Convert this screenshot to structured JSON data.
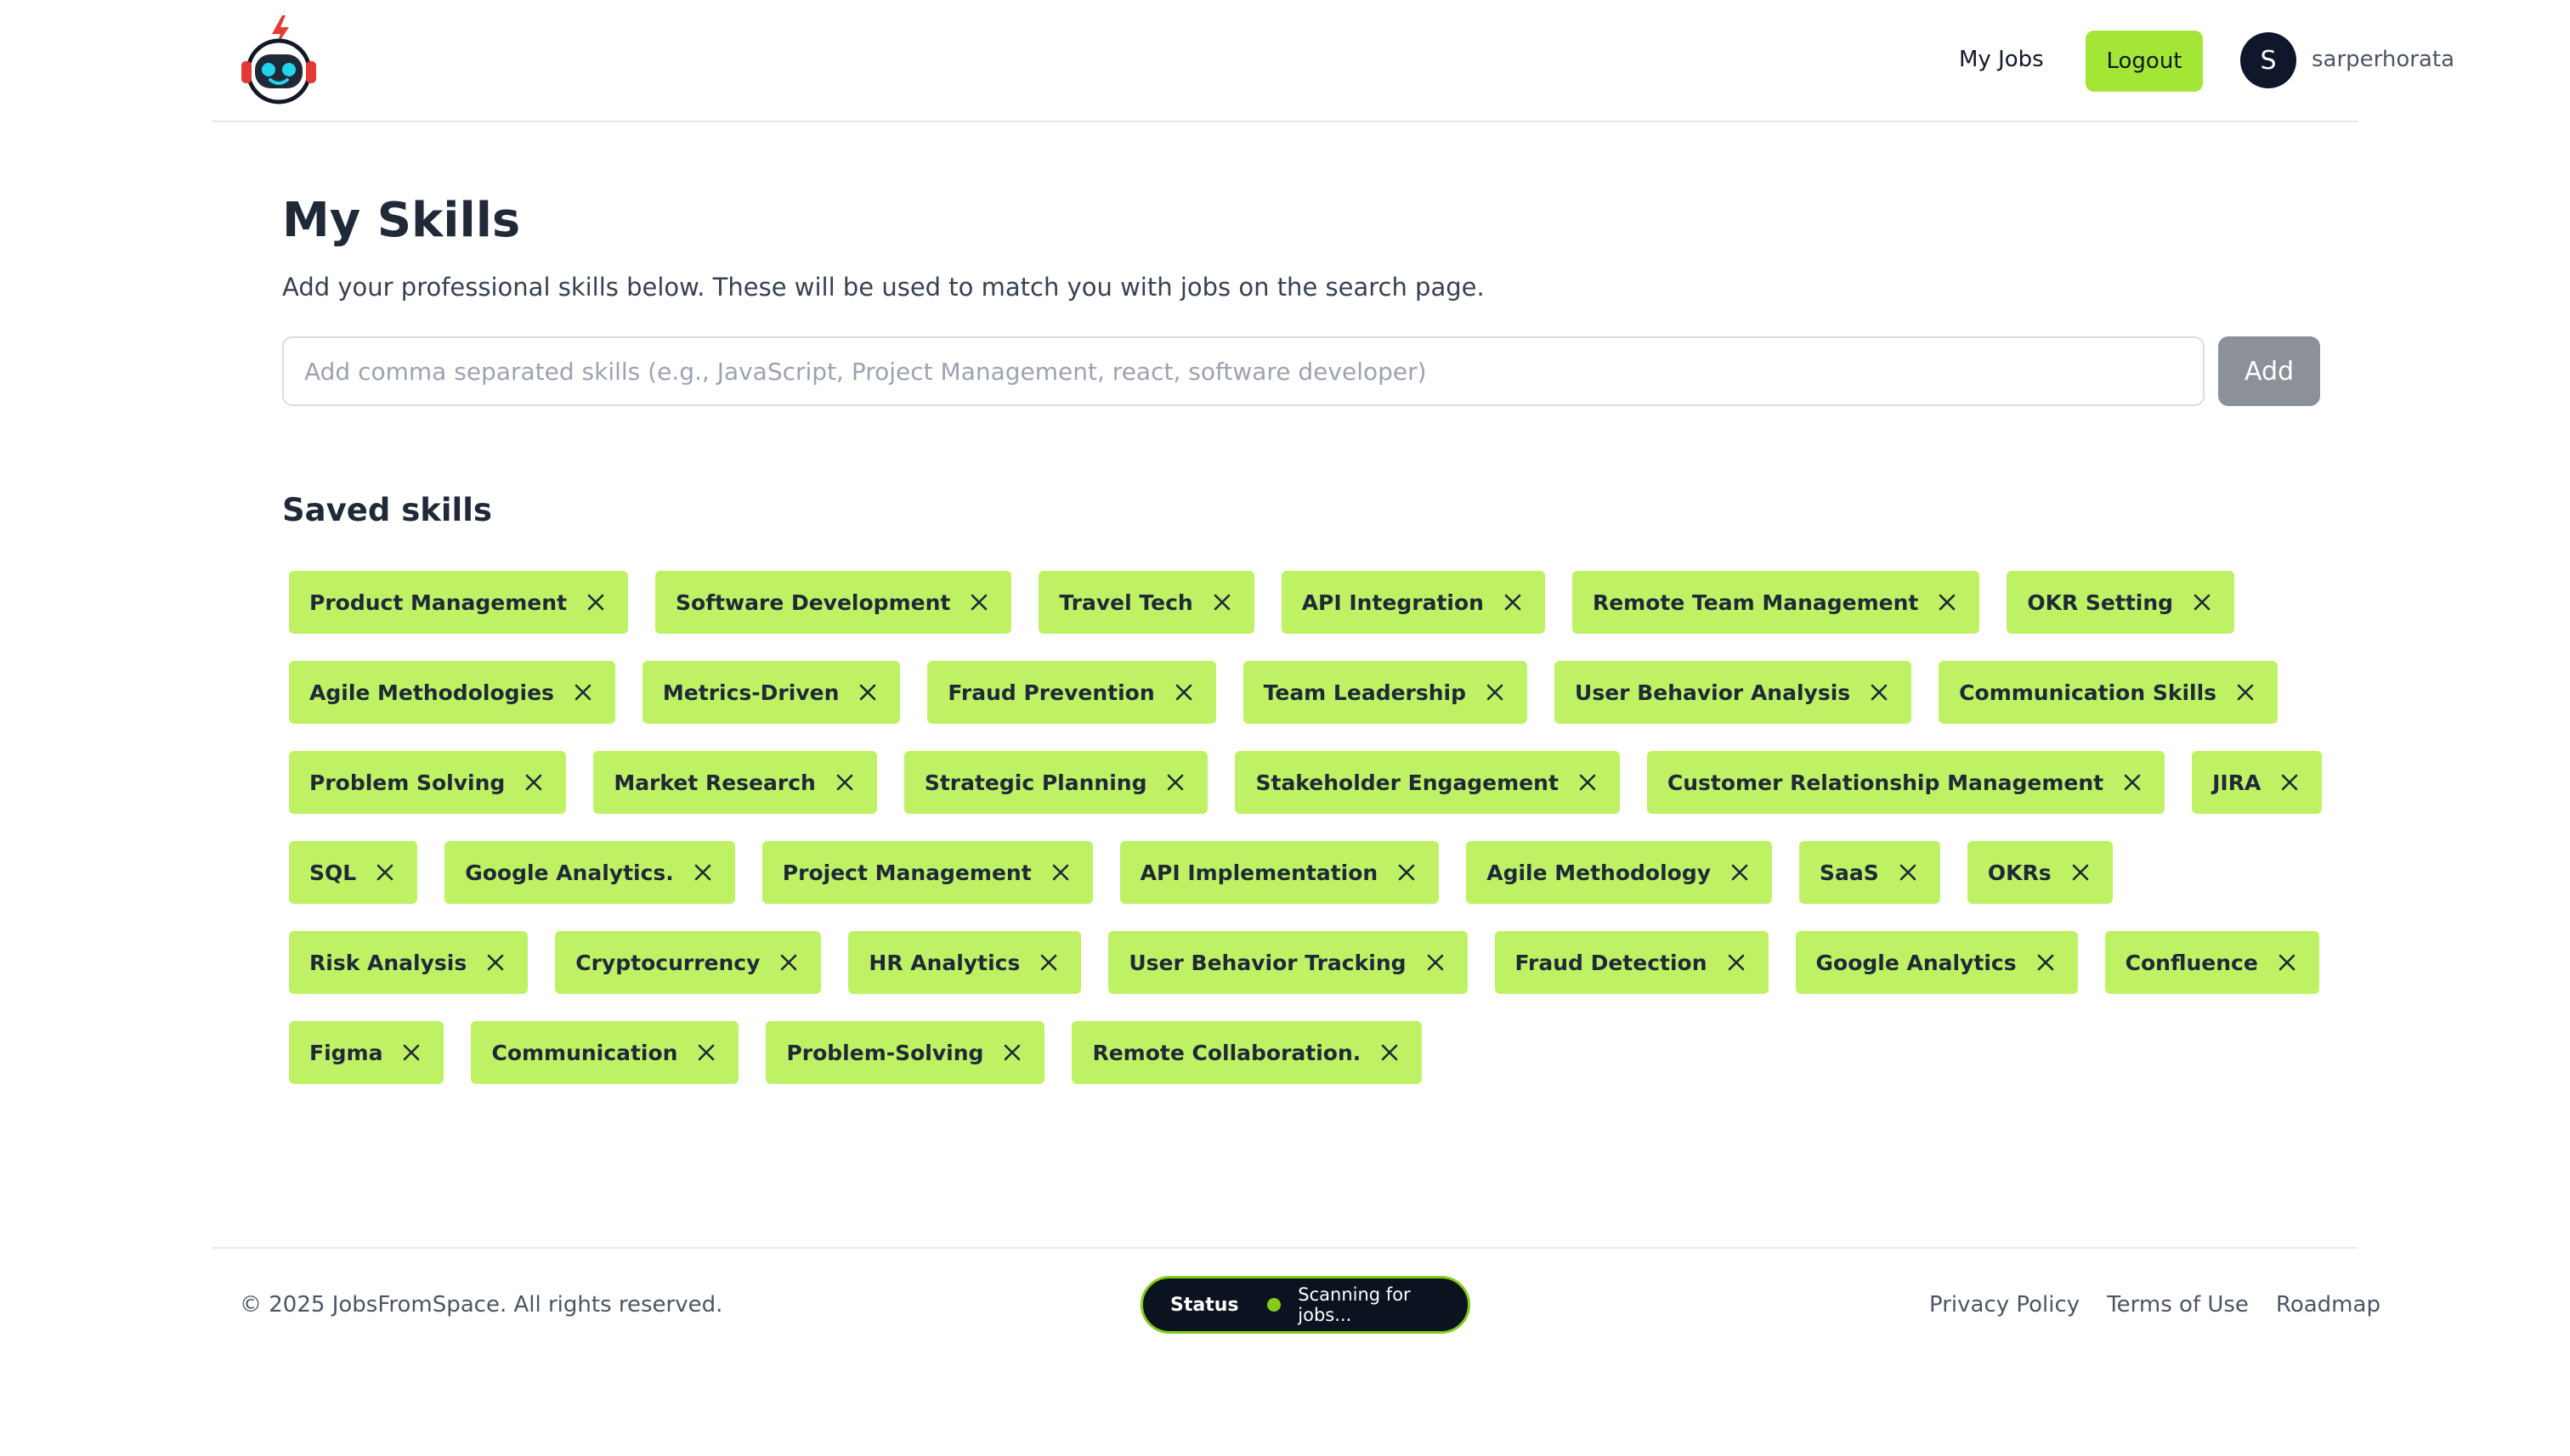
{
  "header": {
    "logo_icon": "robot-astronaut-logo",
    "nav_my_jobs": "My Jobs",
    "logout_label": "Logout",
    "avatar_initial": "S",
    "username": "sarperhorata"
  },
  "main": {
    "title": "My Skills",
    "description": "Add your professional skills below. These will be used to match you with jobs on the search page.",
    "input_placeholder": "Add comma separated skills (e.g., JavaScript, Project Management, react, software developer)",
    "input_value": "",
    "add_label": "Add",
    "saved_heading": "Saved skills",
    "skills": [
      "Product Management",
      "Software Development",
      "Travel Tech",
      "API Integration",
      "Remote Team Management",
      "OKR Setting",
      "Agile Methodologies",
      "Metrics-Driven",
      "Fraud Prevention",
      "Team Leadership",
      "User Behavior Analysis",
      "Communication Skills",
      "Problem Solving",
      "Market Research",
      "Strategic Planning",
      "Stakeholder Engagement",
      "Customer Relationship Management",
      "JIRA",
      "SQL",
      "Google Analytics.",
      "Project Management",
      "API Implementation",
      "Agile Methodology",
      "SaaS",
      "OKRs",
      "Risk Analysis",
      "Cryptocurrency",
      "HR Analytics",
      "User Behavior Tracking",
      "Fraud Detection",
      "Google Analytics",
      "Confluence",
      "Figma",
      "Communication",
      "Problem-Solving",
      "Remote Collaboration."
    ],
    "remove_icon": "close-icon"
  },
  "footer": {
    "copyright": "© 2025 JobsFromSpace. All rights reserved.",
    "status_label": "Status",
    "status_text": "Scanning for jobs...",
    "links": [
      "Privacy Policy",
      "Terms of Use",
      "Roadmap"
    ]
  },
  "colors": {
    "accent": "#a3e635",
    "chip_bg": "#bef264",
    "dark": "#0f172a",
    "add_button": "#8b9099"
  }
}
